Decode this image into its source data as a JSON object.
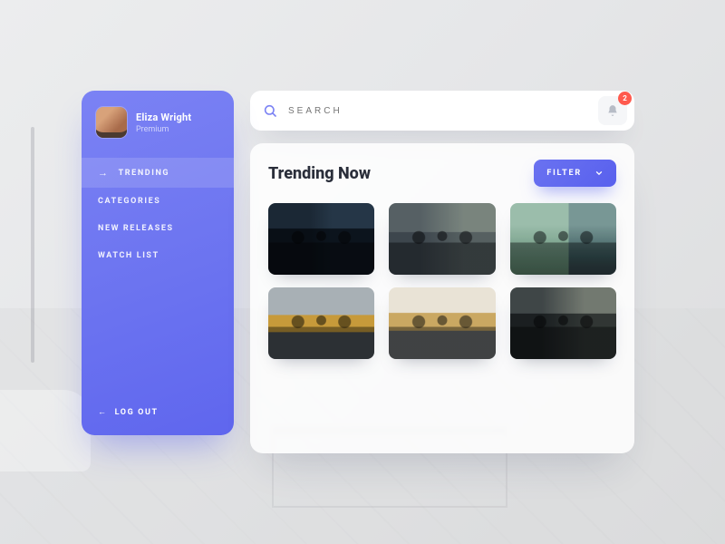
{
  "sidebar": {
    "user_name": "Eliza Wright",
    "user_plan": "Premium",
    "items": [
      {
        "label": "TRENDING",
        "active": true
      },
      {
        "label": "CATEGORIES",
        "active": false
      },
      {
        "label": "NEW RELEASES",
        "active": false
      },
      {
        "label": "WATCH LIST",
        "active": false
      }
    ],
    "logout_label": "LOG OUT"
  },
  "search": {
    "placeholder": "SEARCH",
    "notification_count": "2"
  },
  "content": {
    "title": "Trending Now",
    "filter_label": "FILTER"
  },
  "colors": {
    "accent": "#6a72f0",
    "badge": "#ff5a4e"
  }
}
